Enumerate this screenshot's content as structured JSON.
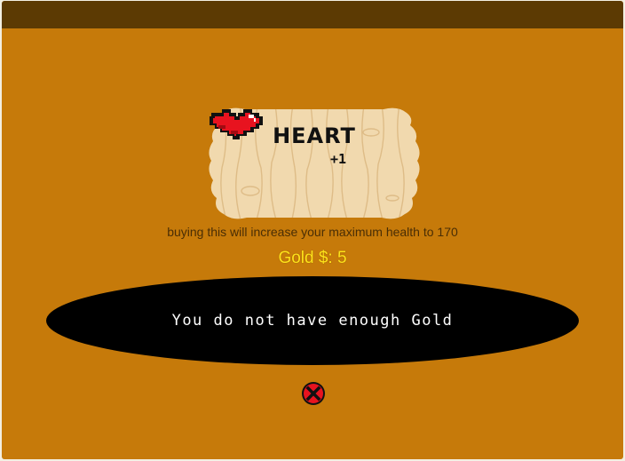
{
  "item": {
    "name": "HEART",
    "bonus": "+1",
    "icon": "heart-icon"
  },
  "description": "buying this will increase your maximum health to 170",
  "gold_display": "Gold $: 5",
  "message": "You do not have enough Gold",
  "close_icon": "close-icon",
  "colors": {
    "background": "#c67a0a",
    "top_bar": "#5c3a03",
    "gold_text": "#ffe21a",
    "message_bg": "#000000",
    "heart": "#e8131f"
  }
}
